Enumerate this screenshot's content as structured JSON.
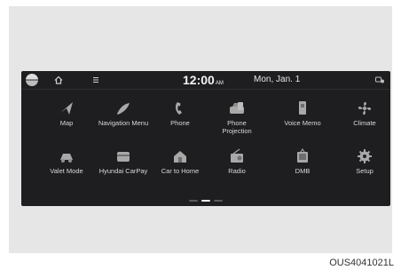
{
  "status_bar": {
    "time": "12:00",
    "ampm": "AM",
    "date": "Mon, Jan. 1"
  },
  "apps": [
    {
      "label": "Map",
      "icon": "map-icon"
    },
    {
      "label": "Navigation Menu",
      "icon": "navigation-menu-icon"
    },
    {
      "label": "Phone",
      "icon": "phone-icon"
    },
    {
      "label": "Phone\nProjection",
      "icon": "phone-projection-icon"
    },
    {
      "label": "Voice Memo",
      "icon": "voice-memo-icon"
    },
    {
      "label": "Climate",
      "icon": "climate-icon"
    },
    {
      "label": "Valet Mode",
      "icon": "valet-mode-icon"
    },
    {
      "label": "Hyundai CarPay",
      "icon": "carpay-icon"
    },
    {
      "label": "Car to Home",
      "icon": "car-to-home-icon"
    },
    {
      "label": "Radio",
      "icon": "radio-icon"
    },
    {
      "label": "DMB",
      "icon": "dmb-icon"
    },
    {
      "label": "Setup",
      "icon": "setup-icon"
    }
  ],
  "pager": {
    "pages": 3,
    "current": 2
  },
  "colors": {
    "screen_bg": "#1e1e20",
    "icon": "#a8a8a8",
    "text": "#d8d8d8",
    "frame_bg": "#e6e6e6"
  },
  "caption": "OUS4041021L"
}
